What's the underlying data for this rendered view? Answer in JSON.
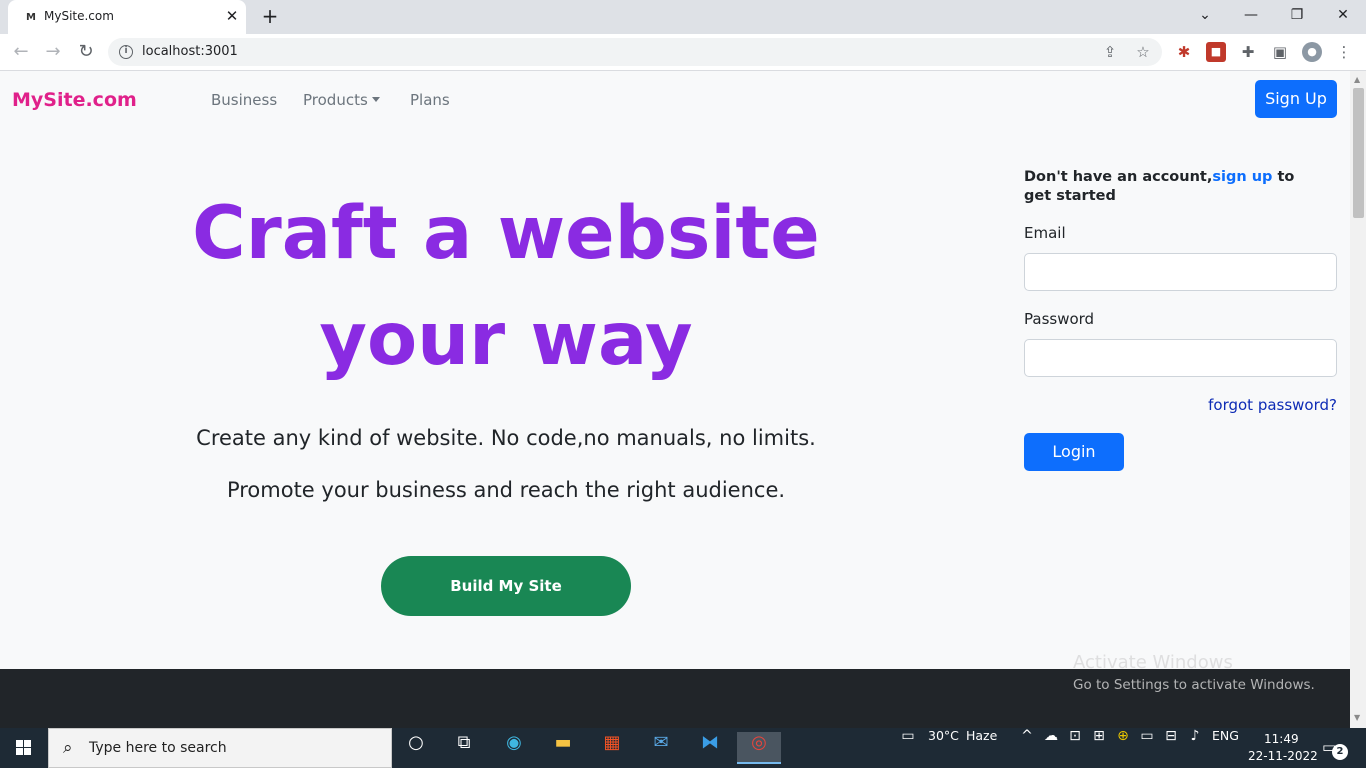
{
  "browser": {
    "tab_favicon": "M",
    "tab_title": "MySite.com",
    "tab_close": "✕",
    "new_tab": "+",
    "url": "localhost:3001",
    "win_min": "—",
    "win_restore": "❐",
    "win_close": "✕",
    "win_chevron": "⌄"
  },
  "site": {
    "brand": "MySite.com",
    "nav": {
      "business": "Business",
      "products": "Products",
      "plans": "Plans"
    },
    "signup_button": "Sign Up",
    "hero": {
      "title_line1": "Craft a website",
      "title_line2": "your way",
      "tagline1": "Create any kind of website. No code,no manuals, no limits.",
      "tagline2": "Promote your business and reach the right audience.",
      "cta": "Build My Site"
    },
    "login": {
      "prompt_before": "Don't have an account,",
      "prompt_link": "sign up",
      "prompt_after": " to get started",
      "email_label": "Email",
      "email_value": "",
      "password_label": "Password",
      "password_value": "",
      "forgot": "forgot password?",
      "login_button": "Login"
    }
  },
  "watermark": {
    "title": "Activate Windows",
    "subtitle": "Go to Settings to activate Windows."
  },
  "taskbar": {
    "search_placeholder": "Type here to search",
    "weather_temp": "30°C",
    "weather_desc": "Haze",
    "language": "ENG",
    "time": "11:49",
    "date": "22-11-2022",
    "notification_count": "2"
  },
  "colors": {
    "brand": "#e0218a",
    "hero_title": "#8a2be2",
    "primary": "#0d6efd",
    "cta": "#198754",
    "footer": "#212529"
  }
}
